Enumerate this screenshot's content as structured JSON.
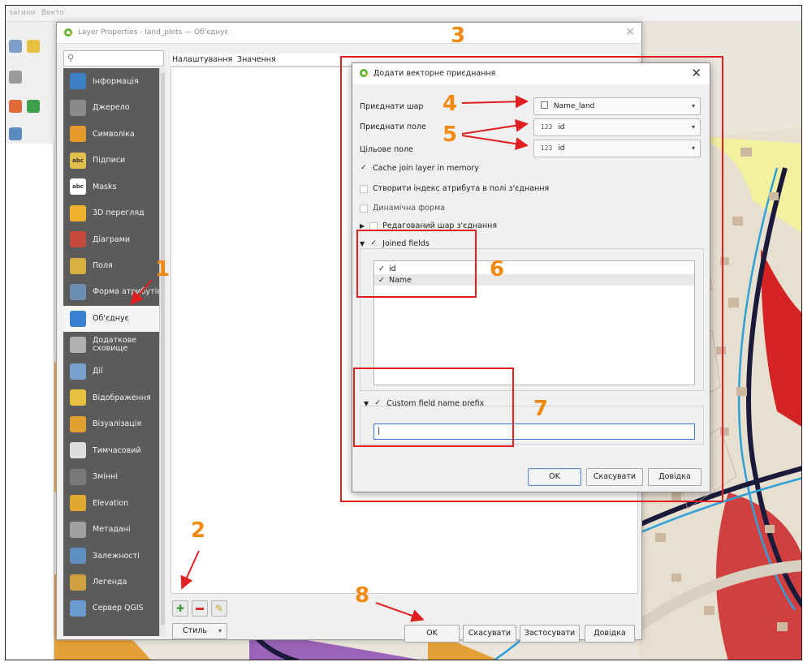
{
  "qgis": {
    "menubar_items": [
      "загини",
      "Векто"
    ],
    "left_panel": {}
  },
  "layer_properties": {
    "title": "Layer Properties - land_plots — Об'єднує",
    "search_placeholder": "",
    "header": {
      "col1": "Налаштування",
      "col2": "Значення"
    },
    "sidebar": [
      {
        "label": "Інформація",
        "icon": "info-icon",
        "color": "#3b7fc4"
      },
      {
        "label": "Джерело",
        "icon": "source-icon",
        "color": "#8a8a8a"
      },
      {
        "label": "Символіка",
        "icon": "symbology-icon",
        "color": "#e59a2b"
      },
      {
        "label": "Підписи",
        "icon": "labels-icon",
        "color": "#e0c04a"
      },
      {
        "label": "Masks",
        "icon": "masks-icon",
        "color": "#ffffff"
      },
      {
        "label": "3D перегляд",
        "icon": "3d-view-icon",
        "color": "#f0b030"
      },
      {
        "label": "Діаграми",
        "icon": "diagrams-icon",
        "color": "#c84a3a"
      },
      {
        "label": "Поля",
        "icon": "fields-icon",
        "color": "#d8b040"
      },
      {
        "label": "Форма атрибутів",
        "icon": "attributes-form-icon",
        "color": "#6a8fb0"
      },
      {
        "label": "Об'єднує",
        "icon": "joins-icon",
        "color": "#3a7fd0"
      },
      {
        "label": "Додаткове сховище",
        "icon": "auxiliary-storage-icon",
        "color": "#b0b0b0"
      },
      {
        "label": "Дії",
        "icon": "actions-icon",
        "color": "#7aa0d0"
      },
      {
        "label": "Відображення",
        "icon": "display-icon",
        "color": "#e8c040"
      },
      {
        "label": "Візуалізація",
        "icon": "rendering-icon",
        "color": "#e0a030"
      },
      {
        "label": "Тимчасовий",
        "icon": "temporal-icon",
        "color": "#dddddd"
      },
      {
        "label": "Змінні",
        "icon": "variables-icon",
        "color": "#7a7a7a"
      },
      {
        "label": "Elevation",
        "icon": "elevation-icon",
        "color": "#e0a830"
      },
      {
        "label": "Метадані",
        "icon": "metadata-icon",
        "color": "#a0a0a0"
      },
      {
        "label": "Залежності",
        "icon": "dependencies-icon",
        "color": "#5f8fc0"
      },
      {
        "label": "Легенда",
        "icon": "legend-icon",
        "color": "#d0a040"
      },
      {
        "label": "Сервер QGIS",
        "icon": "qgis-server-icon",
        "color": "#6a9ad0"
      }
    ],
    "buttons": {
      "style": "Стиль",
      "ok": "OK",
      "cancel": "Скасувати",
      "apply": "Застосувати",
      "help": "Довідка"
    }
  },
  "join_dialog": {
    "title": "Додати векторне приєднання",
    "join_layer_label": "Приєднати шар",
    "join_layer_value": "Name_land",
    "join_field_label": "Приєднати поле",
    "join_field_value": "id",
    "join_field_type": "123",
    "target_field_label": "Цільове поле",
    "target_field_value": "id",
    "target_field_type": "123",
    "cache_label": "Cache join layer in memory",
    "index_label": "Створити індекс атрибута в полі з'єднання",
    "dynamic_form_label": "Динамічна форма",
    "editable_label": "Редагований шар з'єднання",
    "joined_fields_label": "Joined fields",
    "fields": [
      {
        "name": "id",
        "checked": "✓"
      },
      {
        "name": "Name",
        "checked": "✓"
      }
    ],
    "prefix_label": "Custom field name prefix",
    "prefix_value": "",
    "buttons": {
      "ok": "OK",
      "cancel": "Скасувати",
      "help": "Довідка"
    }
  },
  "annotations": {
    "n1": "1",
    "n2": "2",
    "n3": "3",
    "n4": "4",
    "n5": "5",
    "n6": "6",
    "n7": "7",
    "n8": "8",
    "color_box": "#e02020",
    "color_numbers": "#f08a10"
  }
}
